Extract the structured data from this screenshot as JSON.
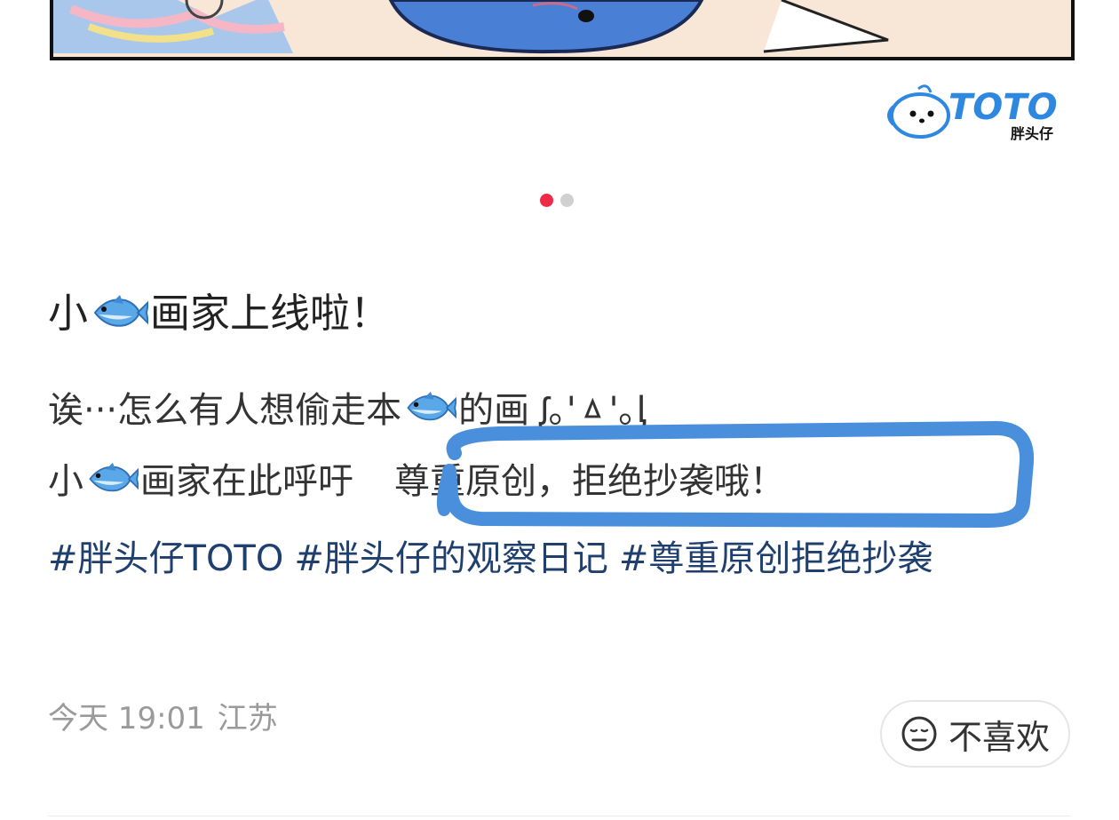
{
  "post": {
    "title_pre": "小",
    "title_post": "画家上线啦！",
    "line1_pre": "诶···怎么有人想偷走本",
    "line1_post": "的画 ᶘ｡'ㅿ'｡ᶅ",
    "line2_pre": "小",
    "line2_mid": "画家在此呼吁",
    "line2_post": "尊重原创，拒绝抄袭哦！",
    "tags": [
      "#胖头仔TOTO",
      "#胖头仔的观察日记",
      "#尊重原创拒绝抄袭"
    ]
  },
  "watermark": {
    "brand": "TOTO",
    "sub": "胖头仔"
  },
  "carousel": {
    "total": 2,
    "active": 1
  },
  "meta": {
    "date": "今天 19:01",
    "location": "江苏"
  },
  "actions": {
    "dislike_label": "不喜欢"
  },
  "colors": {
    "accent_dot": "#ee2a46",
    "hashtag": "#1f3f6e",
    "marker": "#4a8fdc"
  }
}
